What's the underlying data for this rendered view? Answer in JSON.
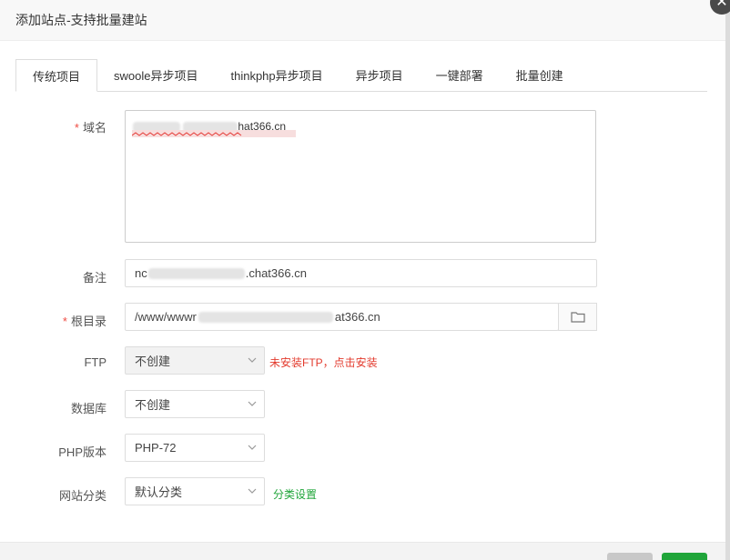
{
  "dialog": {
    "title": "添加站点-支持批量建站",
    "close_symbol": "✕"
  },
  "tabs": [
    {
      "label": "传统项目",
      "active": true
    },
    {
      "label": "swoole异步项目",
      "active": false
    },
    {
      "label": "thinkphp异步项目",
      "active": false
    },
    {
      "label": "异步项目",
      "active": false
    },
    {
      "label": "一键部署",
      "active": false
    },
    {
      "label": "批量创建",
      "active": false
    }
  ],
  "form": {
    "domain": {
      "label": "域名",
      "required_mark": "*",
      "value_visible_suffix": "hat366.cn"
    },
    "remark": {
      "label": "备注",
      "value_prefix": "nc",
      "value_suffix": ".chat366.cn"
    },
    "root": {
      "label": "根目录",
      "required_mark": "*",
      "value_prefix": "/www/wwwr",
      "value_suffix": "at366.cn",
      "button_icon": "folder-icon"
    },
    "ftp": {
      "label": "FTP",
      "value": "不创建",
      "hint": "未安装FTP，点击安装",
      "disabled": true
    },
    "database": {
      "label": "数据库",
      "value": "不创建"
    },
    "php": {
      "label": "PHP版本",
      "value": "PHP-72"
    },
    "category": {
      "label": "网站分类",
      "value": "默认分类",
      "link": "分类设置"
    }
  },
  "colors": {
    "accent": "#20a53a",
    "warning": "#e33a2d",
    "required": "#ef4c43"
  }
}
